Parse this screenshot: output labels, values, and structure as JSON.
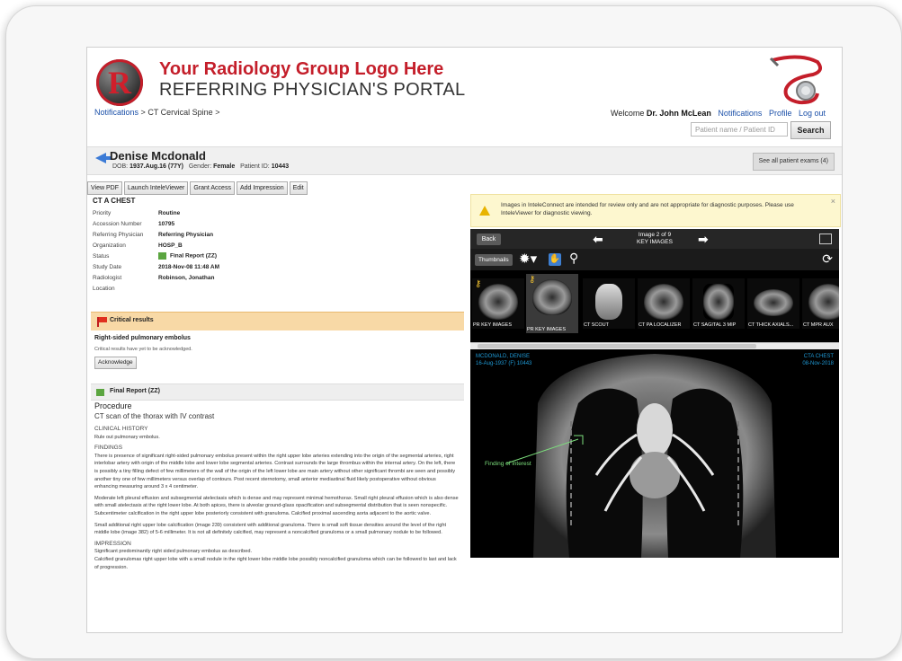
{
  "header": {
    "logo_letter": "R",
    "logo_title": "Your Radiology Group Logo Here",
    "logo_subtitle": "REFERRING PHYSICIAN'S PORTAL"
  },
  "breadcrumb": {
    "item1": "Notifications",
    "sep": ">",
    "item2": "CT Cervical Spine",
    "sep2": ">"
  },
  "user": {
    "welcome_prefix": "Welcome",
    "name": "Dr. John McLean",
    "notifications": "Notifications",
    "profile": "Profile",
    "logout": "Log out"
  },
  "search": {
    "placeholder": "Patient name / Patient ID",
    "button": "Search"
  },
  "patient": {
    "name": "Denise Mcdonald",
    "dob_label": "DOB:",
    "dob": "1937.Aug.16 (77Y)",
    "gender_label": "Gender:",
    "gender": "Female",
    "id_label": "Patient ID:",
    "id": "10443",
    "see_all": "See all patient exams (4)"
  },
  "toolbar": {
    "view_pdf": "View PDF",
    "launch": "Launch InteleViewer",
    "grant": "Grant Access",
    "impression": "Add Impression",
    "edit": "Edit"
  },
  "study": {
    "title": "CT A CHEST",
    "rows": [
      {
        "k": "Priority",
        "v": "Routine"
      },
      {
        "k": "Accession Number",
        "v": "10795"
      },
      {
        "k": "Referring Physician",
        "v": "Referring Physician"
      },
      {
        "k": "Organization",
        "v": "HOSP_B"
      },
      {
        "k": "Status",
        "v": "Final Report (ZZ)"
      },
      {
        "k": "Study Date",
        "v": "2018-Nov-08 11:48 AM"
      },
      {
        "k": "Radiologist",
        "v": "Robinson, Jonathan"
      },
      {
        "k": "Location",
        "v": ""
      }
    ]
  },
  "critical": {
    "header": "Critical results",
    "title": "Right-sided pulmonary embolus",
    "note": "Critical results have yet to be acknowledged.",
    "ack": "Acknowledge"
  },
  "report": {
    "header": "Final Report (ZZ)",
    "procedure_label": "Procedure",
    "procedure": "CT scan of the thorax with IV contrast",
    "history_label": "CLINICAL HISTORY",
    "history": "Rule out pulmonary embolus.",
    "findings_label": "FINDINGS",
    "findings_1": "There is presence of significant right-sided pulmonary embolus present within the right upper lobe arteries extending into the origin of the segmental arteries, right interlobar artery with origin of the middle lobe and lower lobe segmental arteries. Contrast surrounds the large thrombus within the internal artery. On the left, there is possibly a tiny filling defect of few millimeters of the wall of the origin of the left lower lobe are main artery without other significant thrombi are seen and possibly another tiny one of few millimeters versus overlap of contours. Post recent sternotomy, small anterior mediastinal fluid likely postoperative without obvious enhancing measuring around 3 x 4 centimeter.",
    "findings_2": "Moderate left pleural effusion and subsegmental atelectasis which is dense and may represent minimal hemothorax. Small right pleural effusion which is also dense with small atelectasis at the right lower lobe. At both apices, there is alveolar ground-glass opacification and subsegmental distribution that is seen nonspecific. Subcentimeter calcification in the right upper lobe posteriorly consistent with granuloma. Calcified proximal ascending aorta adjacent to the aortic valve.",
    "findings_3": "Small additional right upper lobe calcification (image 239) consistent with additional granuloma. There is small soft tissue densities around the level of the right middle lobe (image 382) of 5-6 millimeter. It is not all definitely calcified, may represent a noncalcified granuloma or a small pulmonary nodule to be followed.",
    "impression_label": "IMPRESSION",
    "impression_1": "Significant predominantly right sided pulmonary embolus as described.",
    "impression_2": "Calcified granulomas right upper lobe with a small nodule in the right lower lobe middle lobe possibly noncalcified granuloma which can be followed to last and lack of progression."
  },
  "notice": {
    "text": "Images in InteleConnect are intended for review only and are not appropriate for diagnostic purposes. Please use InteleViewer for diagnostic viewing.",
    "close": "×"
  },
  "viewer": {
    "back": "Back",
    "image_of": "Image 2 of 9",
    "series": "KEY IMAGES",
    "thumbnails_btn": "Thumbnails",
    "thumbs": [
      {
        "cap": "PR KEY IMAGES"
      },
      {
        "cap": "PR KEY IMAGES"
      },
      {
        "cap": "CT SCOUT"
      },
      {
        "cap": "CT PA LOCALIZER"
      },
      {
        "cap": "CT SAGITAL 3 MIP"
      },
      {
        "cap": "CT THICK AXIALS..."
      },
      {
        "cap": "CT MPR AUX"
      }
    ],
    "overlay_tl_1": "MCDONALD, DENISE",
    "overlay_tl_2": "16-Aug-1937 (F) 10443",
    "overlay_tr_1": "CTA CHEST",
    "overlay_tr_2": "08-Nov-2018",
    "finding_label": "Finding of interest"
  },
  "colors": {
    "brand_red": "#c41e2a",
    "link_blue": "#1a4fa8",
    "critical_bg": "#f8d9a6",
    "notice_bg": "#fdf7cf",
    "viewer_bg": "#262626"
  }
}
